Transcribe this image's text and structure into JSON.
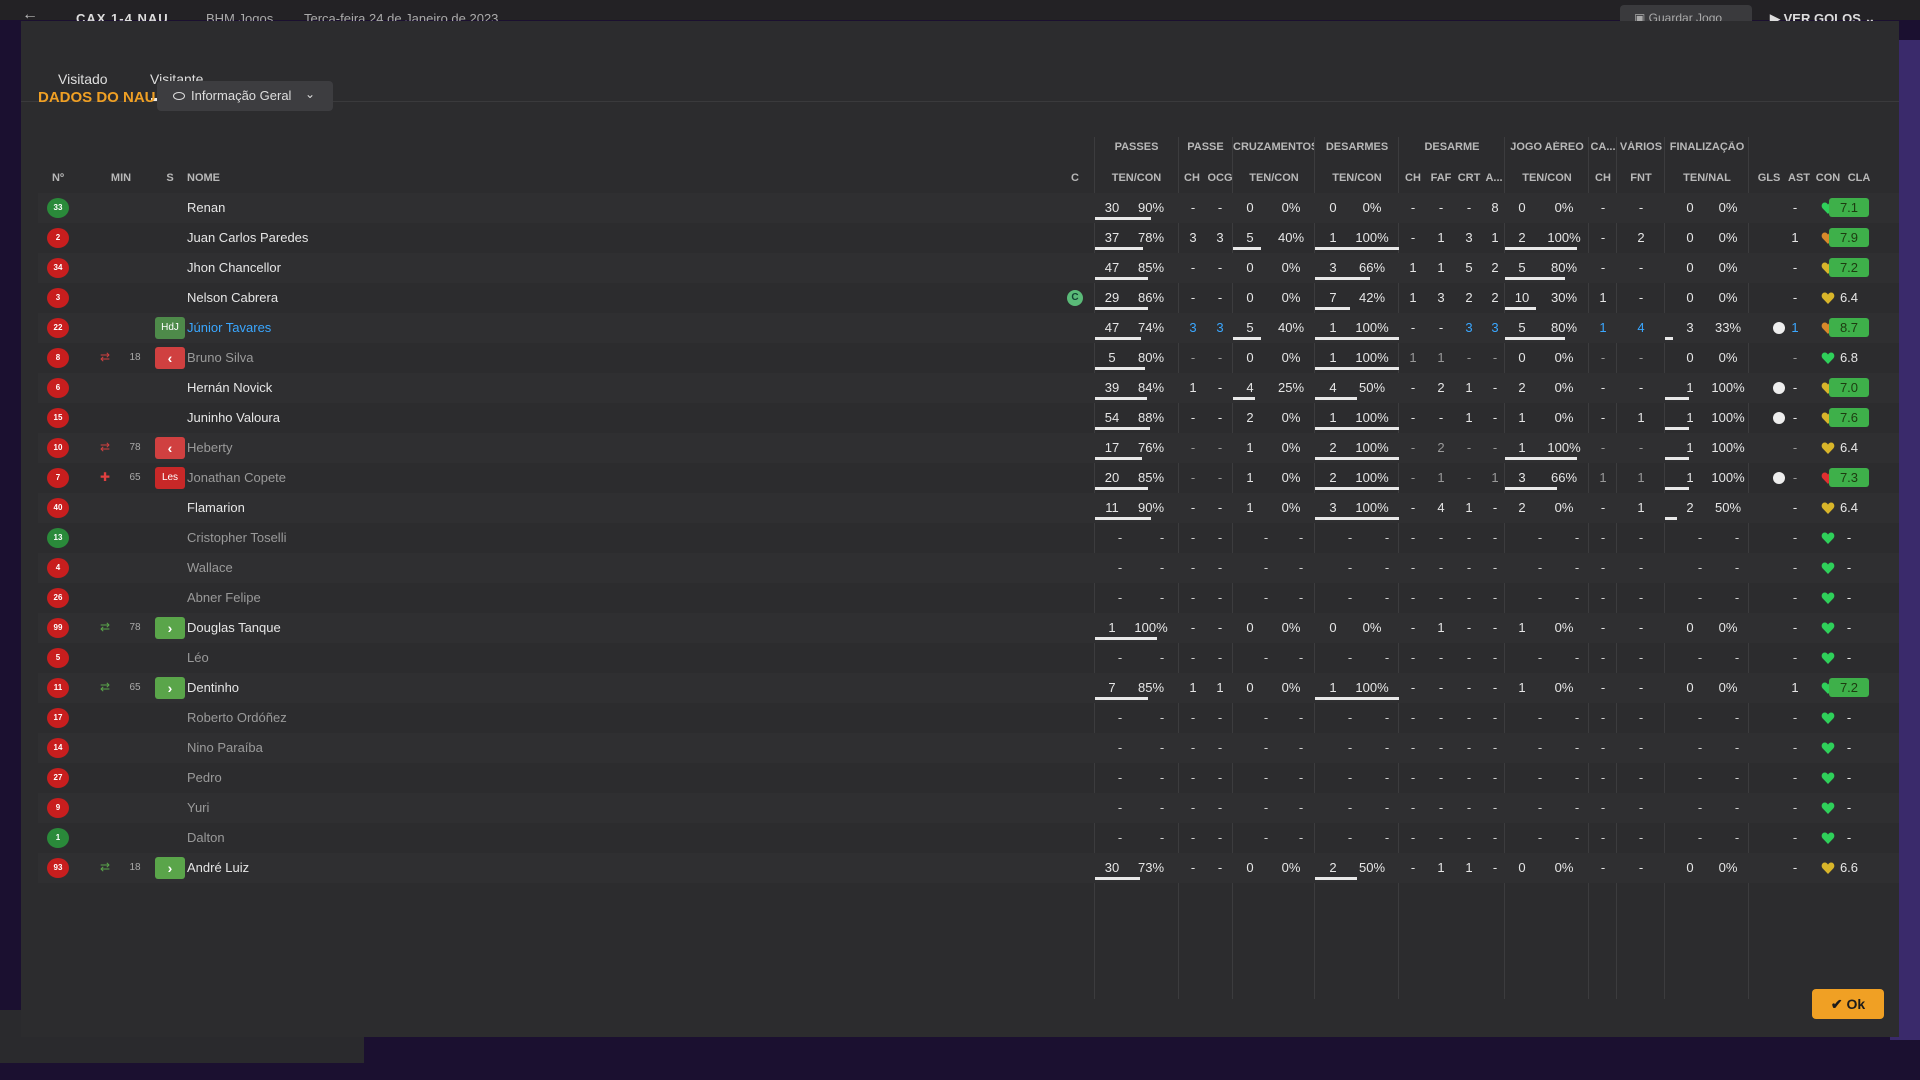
{
  "top_bar": {
    "back_icon": "back-arrow-icon",
    "score": "CAX 1-4 NAU",
    "venue": "BHM Jogos",
    "date": "Terça-feira 24 de Janeiro de 2023",
    "save_label": "Guardar Jogo",
    "golos_label": "VER GOLOS"
  },
  "tabs": [
    "Visitado",
    "Visitante"
  ],
  "section_title": "DADOS DO NAU",
  "dropdown": {
    "label": "Informação Geral",
    "icon": "eye-icon"
  },
  "column_groups": [
    "PASSES",
    "PASSE",
    "CRUZAMENTOS",
    "DESARMES",
    "DESARME",
    "JOGO AÉREO",
    "CA...",
    "VÁRIOS",
    "FINALIZAÇÃO"
  ],
  "columns": {
    "no": "Nº",
    "min": "MIN",
    "s": "S",
    "nome": "NOME",
    "c": "C",
    "passes": "TEN/CON",
    "passe_ch": "CH",
    "passe_ocg": "OCG",
    "cruz": "TEN/CON",
    "desarmes": "TEN/CON",
    "des_ch": "CH",
    "des_faf": "FAF",
    "des_crt": "CRT",
    "des_a": "A...",
    "aereo": "TEN/CON",
    "ca_ch": "CH",
    "varios_fnt": "FNT",
    "final": "TEN/NAL",
    "gls": "GLS",
    "ast": "AST",
    "con": "CON",
    "cla": "CLA"
  },
  "colors": {
    "accent": "#f0a024",
    "rating_green": "#3eb04a",
    "sub_in": "#5aa54a",
    "sub_out": "#d04040",
    "heart_green": "#2fd05a",
    "heart_yellow": "#d8b52a",
    "heart_orange": "#d88a2a"
  },
  "players": [
    {
      "no": "33",
      "gk": true,
      "min": "",
      "sub": "",
      "s": "",
      "name": "Renan",
      "style": "",
      "captain": "",
      "pas_t": "30",
      "pas_p": "90%",
      "pas_bar": 0.9,
      "ch": "-",
      "ocg": "-",
      "cz_t": "0",
      "cz_p": "0%",
      "cz_bar": 0,
      "ds_t": "0",
      "ds_p": "0%",
      "ds_bar": 0,
      "d_ch": "-",
      "d_faf": "-",
      "d_crt": "-",
      "d_a": "8",
      "ae_t": "0",
      "ae_p": "0%",
      "ae_bar": 0,
      "ca": "-",
      "fnt": "-",
      "fi_t": "0",
      "fi_p": "0%",
      "fi_bar": 0,
      "gls": "",
      "ast": "-",
      "con": "green",
      "cla": "7.1",
      "cla_green": true
    },
    {
      "no": "2",
      "gk": false,
      "min": "",
      "sub": "",
      "s": "",
      "name": "Juan Carlos Paredes",
      "style": "",
      "captain": "",
      "pas_t": "37",
      "pas_p": "78%",
      "pas_bar": 0.78,
      "ch": "3",
      "ocg": "3",
      "cz_t": "5",
      "cz_p": "40%",
      "cz_bar": 0.4,
      "ds_t": "1",
      "ds_p": "100%",
      "ds_bar": 1,
      "d_ch": "-",
      "d_faf": "1",
      "d_crt": "3",
      "d_a": "1",
      "ae_t": "2",
      "ae_p": "100%",
      "ae_bar": 1,
      "ca": "-",
      "fnt": "2",
      "fi_t": "0",
      "fi_p": "0%",
      "fi_bar": 0,
      "gls": "",
      "ast": "1",
      "con": "orange",
      "cla": "7.9",
      "cla_green": true
    },
    {
      "no": "34",
      "gk": false,
      "min": "",
      "sub": "",
      "s": "",
      "name": "Jhon Chancellor",
      "style": "",
      "captain": "",
      "pas_t": "47",
      "pas_p": "85%",
      "pas_bar": 0.85,
      "ch": "-",
      "ocg": "-",
      "cz_t": "0",
      "cz_p": "0%",
      "cz_bar": 0,
      "ds_t": "3",
      "ds_p": "66%",
      "ds_bar": 0.66,
      "d_ch": "1",
      "d_faf": "1",
      "d_crt": "5",
      "d_a": "2",
      "ae_t": "5",
      "ae_p": "80%",
      "ae_bar": 0.8,
      "ca": "-",
      "fnt": "-",
      "fi_t": "0",
      "fi_p": "0%",
      "fi_bar": 0,
      "gls": "",
      "ast": "-",
      "con": "yellow",
      "cla": "7.2",
      "cla_green": true
    },
    {
      "no": "3",
      "gk": false,
      "min": "",
      "sub": "",
      "s": "",
      "name": "Nelson Cabrera",
      "style": "",
      "captain": "C",
      "pas_t": "29",
      "pas_p": "86%",
      "pas_bar": 0.86,
      "ch": "-",
      "ocg": "-",
      "cz_t": "0",
      "cz_p": "0%",
      "cz_bar": 0,
      "ds_t": "7",
      "ds_p": "42%",
      "ds_bar": 0.42,
      "d_ch": "1",
      "d_faf": "3",
      "d_crt": "2",
      "d_a": "2",
      "ae_t": "10",
      "ae_p": "30%",
      "ae_bar": 0.3,
      "ca": "1",
      "fnt": "-",
      "fi_t": "0",
      "fi_p": "0%",
      "fi_bar": 0,
      "gls": "",
      "ast": "-",
      "con": "yellow",
      "cla": "6.4",
      "cla_green": false
    },
    {
      "no": "22",
      "gk": false,
      "min": "",
      "sub": "",
      "s": "mot",
      "s_label": "HdJ",
      "name": "Júnior Tavares",
      "style": "hl",
      "captain": "",
      "pas_t": "47",
      "pas_p": "74%",
      "pas_bar": 0.74,
      "ch": "3",
      "ocg": "3",
      "cz_t": "5",
      "cz_p": "40%",
      "cz_bar": 0.4,
      "ds_t": "1",
      "ds_p": "100%",
      "ds_bar": 1,
      "d_ch": "-",
      "d_faf": "-",
      "d_crt": "3",
      "d_a": "3",
      "ae_t": "5",
      "ae_p": "80%",
      "ae_bar": 0.8,
      "ca": "1",
      "fnt": "4",
      "fi_t": "3",
      "fi_p": "33%",
      "fi_bar": 0.33,
      "gls": "ball",
      "ast": "1",
      "con": "orange",
      "cla": "8.7",
      "cla_green": true
    },
    {
      "no": "8",
      "gk": false,
      "min": "18",
      "sub": "out",
      "s": "out",
      "name": "Bruno Silva",
      "style": "dim",
      "captain": "",
      "pas_t": "5",
      "pas_p": "80%",
      "pas_bar": 0.8,
      "ch": "-",
      "ocg": "-",
      "cz_t": "0",
      "cz_p": "0%",
      "cz_bar": 0,
      "ds_t": "1",
      "ds_p": "100%",
      "ds_bar": 1,
      "d_ch": "1",
      "d_faf": "1",
      "d_crt": "-",
      "d_a": "-",
      "ae_t": "0",
      "ae_p": "0%",
      "ae_bar": 0,
      "ca": "-",
      "fnt": "-",
      "fi_t": "0",
      "fi_p": "0%",
      "fi_bar": 0,
      "gls": "",
      "ast": "-",
      "con": "green",
      "cla": "6.8",
      "cla_green": false
    },
    {
      "no": "6",
      "gk": false,
      "min": "",
      "sub": "",
      "s": "",
      "name": "Hernán Novick",
      "style": "",
      "captain": "",
      "pas_t": "39",
      "pas_p": "84%",
      "pas_bar": 0.84,
      "ch": "1",
      "ocg": "-",
      "cz_t": "4",
      "cz_p": "25%",
      "cz_bar": 0.25,
      "ds_t": "4",
      "ds_p": "50%",
      "ds_bar": 0.5,
      "d_ch": "-",
      "d_faf": "2",
      "d_crt": "1",
      "d_a": "-",
      "ae_t": "2",
      "ae_p": "0%",
      "ae_bar": 0,
      "ca": "-",
      "fnt": "-",
      "fi_t": "1",
      "fi_p": "100%",
      "fi_bar": 1,
      "gls": "ball",
      "ast": "-",
      "con": "yellow",
      "cla": "7.0",
      "cla_green": true
    },
    {
      "no": "15",
      "gk": false,
      "min": "",
      "sub": "",
      "s": "",
      "name": "Juninho Valoura",
      "style": "",
      "captain": "",
      "pas_t": "54",
      "pas_p": "88%",
      "pas_bar": 0.88,
      "ch": "-",
      "ocg": "-",
      "cz_t": "2",
      "cz_p": "0%",
      "cz_bar": 0,
      "ds_t": "1",
      "ds_p": "100%",
      "ds_bar": 1,
      "d_ch": "-",
      "d_faf": "-",
      "d_crt": "1",
      "d_a": "-",
      "ae_t": "1",
      "ae_p": "0%",
      "ae_bar": 0,
      "ca": "-",
      "fnt": "1",
      "fi_t": "1",
      "fi_p": "100%",
      "fi_bar": 1,
      "gls": "ball",
      "ast": "-",
      "con": "yellow",
      "cla": "7.6",
      "cla_green": true
    },
    {
      "no": "10",
      "gk": false,
      "min": "78",
      "sub": "out",
      "s": "out",
      "name": "Heberty",
      "style": "dim",
      "captain": "",
      "pas_t": "17",
      "pas_p": "76%",
      "pas_bar": 0.76,
      "ch": "-",
      "ocg": "-",
      "cz_t": "1",
      "cz_p": "0%",
      "cz_bar": 0,
      "ds_t": "2",
      "ds_p": "100%",
      "ds_bar": 1,
      "d_ch": "-",
      "d_faf": "2",
      "d_crt": "-",
      "d_a": "-",
      "ae_t": "1",
      "ae_p": "100%",
      "ae_bar": 1,
      "ca": "-",
      "fnt": "-",
      "fi_t": "1",
      "fi_p": "100%",
      "fi_bar": 1,
      "gls": "",
      "ast": "-",
      "con": "yellow",
      "cla": "6.4",
      "cla_green": false
    },
    {
      "no": "7",
      "gk": false,
      "min": "65",
      "sub": "inj",
      "s": "les",
      "s_label": "Les",
      "name": "Jonathan Copete",
      "style": "dim",
      "captain": "",
      "pas_t": "20",
      "pas_p": "85%",
      "pas_bar": 0.85,
      "ch": "-",
      "ocg": "-",
      "cz_t": "1",
      "cz_p": "0%",
      "cz_bar": 0,
      "ds_t": "2",
      "ds_p": "100%",
      "ds_bar": 1,
      "d_ch": "-",
      "d_faf": "1",
      "d_crt": "-",
      "d_a": "1",
      "ae_t": "3",
      "ae_p": "66%",
      "ae_bar": 0.66,
      "ca": "1",
      "fnt": "1",
      "fi_t": "1",
      "fi_p": "100%",
      "fi_bar": 1,
      "gls": "ball",
      "ast": "-",
      "con": "red",
      "cla": "7.3",
      "cla_green": true
    },
    {
      "no": "40",
      "gk": false,
      "min": "",
      "sub": "",
      "s": "",
      "name": "Flamarion",
      "style": "",
      "captain": "",
      "pas_t": "11",
      "pas_p": "90%",
      "pas_bar": 0.9,
      "ch": "-",
      "ocg": "-",
      "cz_t": "1",
      "cz_p": "0%",
      "cz_bar": 0,
      "ds_t": "3",
      "ds_p": "100%",
      "ds_bar": 1,
      "d_ch": "-",
      "d_faf": "4",
      "d_crt": "1",
      "d_a": "-",
      "ae_t": "2",
      "ae_p": "0%",
      "ae_bar": 0,
      "ca": "-",
      "fnt": "1",
      "fi_t": "2",
      "fi_p": "50%",
      "fi_bar": 0.5,
      "gls": "",
      "ast": "-",
      "con": "yellow",
      "cla": "6.4",
      "cla_green": false
    },
    {
      "no": "13",
      "gk": true,
      "min": "",
      "sub": "",
      "s": "",
      "name": "Cristopher Toselli",
      "style": "dim",
      "captain": "",
      "empty": true,
      "con": "green",
      "cla": "-"
    },
    {
      "no": "4",
      "gk": false,
      "min": "",
      "sub": "",
      "s": "",
      "name": "Wallace",
      "style": "dim",
      "captain": "",
      "empty": true,
      "con": "green",
      "cla": "-"
    },
    {
      "no": "26",
      "gk": false,
      "min": "",
      "sub": "",
      "s": "",
      "name": "Abner Felipe",
      "style": "dim",
      "captain": "",
      "empty": true,
      "con": "green",
      "cla": "-"
    },
    {
      "no": "99",
      "gk": false,
      "min": "78",
      "sub": "in",
      "s": "in",
      "name": "Douglas Tanque",
      "style": "",
      "captain": "",
      "pas_t": "1",
      "pas_p": "100%",
      "pas_bar": 1,
      "ch": "-",
      "ocg": "-",
      "cz_t": "0",
      "cz_p": "0%",
      "cz_bar": 0,
      "ds_t": "0",
      "ds_p": "0%",
      "ds_bar": 0,
      "d_ch": "-",
      "d_faf": "1",
      "d_crt": "-",
      "d_a": "-",
      "ae_t": "1",
      "ae_p": "0%",
      "ae_bar": 0,
      "ca": "-",
      "fnt": "-",
      "fi_t": "0",
      "fi_p": "0%",
      "fi_bar": 0,
      "gls": "",
      "ast": "-",
      "con": "green",
      "cla": "-",
      "cla_green": false
    },
    {
      "no": "5",
      "gk": false,
      "min": "",
      "sub": "",
      "s": "",
      "name": "Léo",
      "style": "dim",
      "captain": "",
      "empty": true,
      "con": "green",
      "cla": "-"
    },
    {
      "no": "11",
      "gk": false,
      "min": "65",
      "sub": "in",
      "s": "in",
      "name": "Dentinho",
      "style": "",
      "captain": "",
      "pas_t": "7",
      "pas_p": "85%",
      "pas_bar": 0.85,
      "ch": "1",
      "ocg": "1",
      "cz_t": "0",
      "cz_p": "0%",
      "cz_bar": 0,
      "ds_t": "1",
      "ds_p": "100%",
      "ds_bar": 1,
      "d_ch": "-",
      "d_faf": "-",
      "d_crt": "-",
      "d_a": "-",
      "ae_t": "1",
      "ae_p": "0%",
      "ae_bar": 0,
      "ca": "-",
      "fnt": "-",
      "fi_t": "0",
      "fi_p": "0%",
      "fi_bar": 0,
      "gls": "",
      "ast": "1",
      "con": "green",
      "cla": "7.2",
      "cla_green": true
    },
    {
      "no": "17",
      "gk": false,
      "min": "",
      "sub": "",
      "s": "",
      "name": "Roberto Ordóñez",
      "style": "dim",
      "captain": "",
      "empty": true,
      "con": "green",
      "cla": "-"
    },
    {
      "no": "14",
      "gk": false,
      "min": "",
      "sub": "",
      "s": "",
      "name": "Nino Paraíba",
      "style": "dim",
      "captain": "",
      "empty": true,
      "con": "green",
      "cla": "-"
    },
    {
      "no": "27",
      "gk": false,
      "min": "",
      "sub": "",
      "s": "",
      "name": "Pedro",
      "style": "dim",
      "captain": "",
      "empty": true,
      "con": "green",
      "cla": "-"
    },
    {
      "no": "9",
      "gk": false,
      "min": "",
      "sub": "",
      "s": "",
      "name": "Yuri",
      "style": "dim",
      "captain": "",
      "empty": true,
      "con": "green",
      "cla": "-"
    },
    {
      "no": "1",
      "gk": true,
      "min": "",
      "sub": "",
      "s": "",
      "name": "Dalton",
      "style": "dim",
      "captain": "",
      "empty": true,
      "con": "green",
      "cla": "-"
    },
    {
      "no": "93",
      "gk": false,
      "min": "18",
      "sub": "in",
      "s": "in",
      "name": "André Luiz",
      "style": "",
      "captain": "",
      "pas_t": "30",
      "pas_p": "73%",
      "pas_bar": 0.73,
      "ch": "-",
      "ocg": "-",
      "cz_t": "0",
      "cz_p": "0%",
      "cz_bar": 0,
      "ds_t": "2",
      "ds_p": "50%",
      "ds_bar": 0.5,
      "d_ch": "-",
      "d_faf": "1",
      "d_crt": "1",
      "d_a": "-",
      "ae_t": "0",
      "ae_p": "0%",
      "ae_bar": 0,
      "ca": "-",
      "fnt": "-",
      "fi_t": "0",
      "fi_p": "0%",
      "fi_bar": 0,
      "gls": "",
      "ast": "-",
      "con": "yellow",
      "cla": "6.6",
      "cla_green": false
    }
  ],
  "ok_label": "Ok"
}
